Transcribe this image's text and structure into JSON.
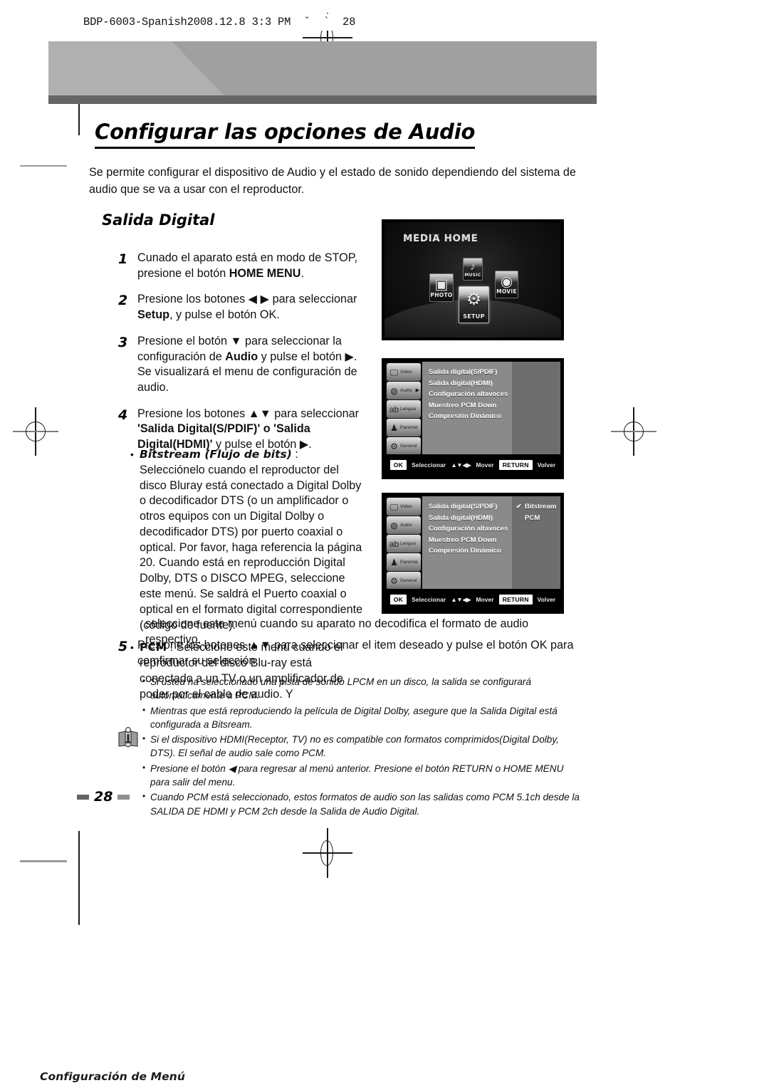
{
  "file_header": "BDP-6003-Spanish2008.12.8 3:3 PM  ˇ  `  28",
  "banner": {
    "chapter_label": "Configuración de Menú"
  },
  "page": {
    "title": "Configurar las opciones de Audio",
    "intro": "Se permite configurar el dispositivo de Audio y el estado de sonido dependiendo del sistema de audio que se va a usar con el reproductor.",
    "section_heading": "Salida Digital",
    "page_number": "28"
  },
  "steps": [
    {
      "num": "1",
      "text_a": "Cunado el aparato está en modo de STOP, presione el botón ",
      "bold_b": "HOME MENU",
      "text_c": "."
    },
    {
      "num": "2",
      "text_a": "Presione los botones ◀ ▶ para seleccionar ",
      "bold_b": "Setup",
      "text_c": ", y pulse el botón OK."
    },
    {
      "num": "3",
      "text_a": "Presione el botón ▼ para seleccionar la configuración de ",
      "bold_b": "Audio",
      "text_c": " y pulse el botón ▶. Se visualizará el menu de configuración de audio."
    },
    {
      "num": "4",
      "text_a": "Presione los botones ▲▼ para seleccionar ",
      "bold_b": "'Salida Digital(S/PDIF)' o 'Salida Digital(HDMI)'",
      "text_c": " y pulse el botón ▶."
    }
  ],
  "sub_bullets": [
    {
      "term": "Bitstream (Flujo de bits)",
      "term_style": "italic",
      "text": " : Selecciónelo cuando el reproductor del disco Bluray está conectado a Digital Dolby o decodificador DTS (o un amplificador o otros equipos con un Digital Dolby o decodificador DTS) por puerto coaxial o optical. Por favor, haga referencia la página 20. Cuando está en reproducción Digital Dolby, DTS o DISCO MPEG, seleccione este menú. Se saldrá el Puerto coaxial o optical en el formato digital correspondiente (código de fuente)."
    },
    {
      "term": "PCM",
      "term_style": "upright",
      "text": " : Seleccione este menú cuando el reproductor del disco Blu-ray está conectado a un TV o un amplificador de poder por el cable de audio. Y"
    }
  ],
  "pcm_tail": "seleccione este menú cuando su aparato no decodifica el formato de audio respectivo.",
  "step5": {
    "num": "5",
    "text": "Presione los botones ▲▼ para seleccionar el item deseado y pulse el botón OK para comfirmar su selección."
  },
  "notes": [
    "Si usted ha seleccionado una pista de sonido LPCM en un disco, la salida se configurará automáticamente a PCM.",
    "Mientras que está reproduciendo la película de Digital Dolby, asegure que la Salida Digital está configurada a Bitsream.",
    "Si el dispositivo HDMI(Receptor, TV) no es compatible con formatos comprimidos(Digital Dolby, DTS). El señal de audio sale como PCM.",
    "Presione el botón ◀ para regresar al menú anterior. Presione el botón RETURN o HOME MENU para salir del menu.",
    "Cuando PCM está seleccionado, estos formatos de audio son las salidas como PCM 5.1ch desde la SALIDA DE HDMI y PCM 2ch desde la Salida de Audio Digital."
  ],
  "media_home": {
    "title": "MEDIA HOME",
    "icons": [
      {
        "label": "PHOTO",
        "glyph": "🖼"
      },
      {
        "label": "MUSIC",
        "glyph": "♪"
      },
      {
        "label": "SETUP",
        "glyph": "⚙"
      },
      {
        "label": "MOVIE",
        "glyph": "🎞"
      }
    ]
  },
  "osd": {
    "sidebar": [
      {
        "label": "Video",
        "icon": "monitor-icon",
        "glyph": "🖵",
        "selected": false
      },
      {
        "label": "Audio",
        "icon": "speaker-icon",
        "glyph": "◖",
        "selected": true
      },
      {
        "label": "Lengua",
        "icon": "abc-icon",
        "glyph": "ab",
        "selected": false
      },
      {
        "label": "Parental",
        "icon": "person-icon",
        "glyph": "♟",
        "selected": false
      },
      {
        "label": "General",
        "icon": "gear-icon",
        "glyph": "⚙",
        "selected": false
      }
    ],
    "menu_items": [
      "Salida digital(S/PDIF)",
      "Salida digital(HDMI)",
      "Configuración altavoces",
      "Muestreo PCM Down",
      "Compresión Dinámico"
    ],
    "options": [
      {
        "label": "Bitstream",
        "checked": true
      },
      {
        "label": "PCM",
        "checked": false
      }
    ],
    "bottom_bar": {
      "ok_key": "OK",
      "ok_label": "Seleccionar",
      "arrows": "▲▼◀▶",
      "move_label": "Mover",
      "return_key": "RETURN",
      "return_label": "Volver"
    }
  }
}
